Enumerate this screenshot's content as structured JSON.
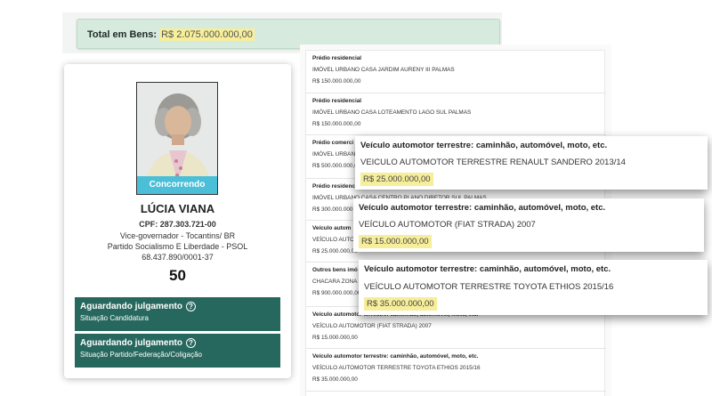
{
  "total": {
    "label": "Total em Bens:",
    "value": "R$ 2.075.000.000,00"
  },
  "candidate": {
    "status": "Concorrendo",
    "name": "LÚCIA VIANA",
    "cpf": "CPF: 287.303.721-00",
    "role": "Vice-governador - Tocantins/ BR",
    "party": "Partido Socialismo E Liberdade - PSOL",
    "cnpj": "68.437.890/0001-37",
    "number": "50",
    "statuses": [
      {
        "title": "Aguardando julgamento",
        "subtitle": "Situação Candidatura"
      },
      {
        "title": "Aguardando julgamento",
        "subtitle": "Situação Partido/Federação/Coligação"
      }
    ]
  },
  "assets": [
    {
      "type": "Prédio residencial",
      "description": "IMÓVEL URBANO CASA JARDIM AURENY III PALMAS",
      "value": "R$ 150.000.000,00"
    },
    {
      "type": "Prédio residencial",
      "description": "IMÓVEL URBANO CASA LOTEAMENTO LAGO SUL PALMAS",
      "value": "R$ 150.000.000,00"
    },
    {
      "type": "Prédio comerci",
      "description": "IMÓVEL URBANO",
      "value": "R$ 500.000.000,00"
    },
    {
      "type": "Prédio residenc",
      "description": "IMÓVEL URBANO CASA CENTRO PLANO DIRETOR SUL PALMAS",
      "value": "R$ 300.000.000,00"
    },
    {
      "type": "Veículo autom",
      "description": "VEÍCULO AUTOM",
      "value": "R$ 25.000.000,00"
    },
    {
      "type": "Outros bens imó",
      "description": "CHACARA ZONA",
      "value": "R$ 900.000.000,00"
    },
    {
      "type": "Veículo automotor terrestre: caminhão, automóvel, moto, etc.",
      "description": "VEÍCULO AUTOMOTOR (FIAT STRADA) 2007",
      "value": "R$ 15.000.000,00"
    },
    {
      "type": "Veículo automotor terrestre: caminhão, automóvel, moto, etc.",
      "description": "VEÍCULO AUTOMOTOR TERRESTRE TOYOTA ETHIOS 2015/16",
      "value": "R$ 35.000.000,00"
    }
  ],
  "popups": [
    {
      "type": "Veículo automotor terrestre: caminhão, automóvel, moto, etc.",
      "description": "VEICULO AUTOMOTOR TERRESTRE RENAULT SANDERO 2013/14",
      "value": "R$ 25.000.000,00"
    },
    {
      "type": "Veículo automotor terrestre: caminhão, automóvel, moto, etc.",
      "description": "VEÍCULO AUTOMOTOR (FIAT STRADA) 2007",
      "value": "R$ 15.000.000,00"
    },
    {
      "type": "Veículo automotor terrestre: caminhão, automóvel, moto, etc.",
      "description": "VEÍCULO AUTOMOTOR TERRESTRE TOYOTA ETHIOS 2015/16",
      "value": "R$ 35.000.000,00"
    }
  ],
  "colors": {
    "total_bg": "#d6eadd",
    "highlight": "#f6ee9a",
    "status_band": "#4bbfd8",
    "status_box": "#27685e"
  },
  "icons": {
    "status_help": "help-circle-icon"
  }
}
